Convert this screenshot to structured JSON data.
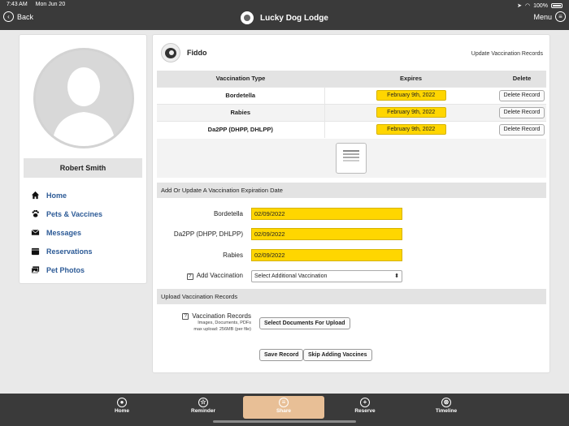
{
  "status": {
    "time": "7:43 AM",
    "date": "Mon Jun 20",
    "battery": "100%"
  },
  "header": {
    "back_label": "Back",
    "title": "Lucky Dog Lodge",
    "menu_label": "Menu"
  },
  "sidebar": {
    "user_name": "Robert Smith",
    "items": [
      {
        "label": "Home",
        "icon": "home-icon"
      },
      {
        "label": "Pets & Vaccines",
        "icon": "paw-icon"
      },
      {
        "label": "Messages",
        "icon": "envelope-icon"
      },
      {
        "label": "Reservations",
        "icon": "calendar-icon"
      },
      {
        "label": "Pet Photos",
        "icon": "photos-icon"
      }
    ],
    "link_color": "#2c5a96"
  },
  "pet": {
    "name": "Fiddo",
    "update_link": "Update Vaccination Records"
  },
  "vax_table": {
    "headers": [
      "Vaccination Type",
      "Expires",
      "Delete"
    ],
    "rows": [
      {
        "type": "Bordetella",
        "expires": "February 9th, 2022",
        "action": "Delete Record"
      },
      {
        "type": "Rabies",
        "expires": "February 9th, 2022",
        "action": "Delete Record"
      },
      {
        "type": "Da2PP (DHPP, DHLPP)",
        "expires": "February 9th, 2022",
        "action": "Delete Record"
      }
    ]
  },
  "update_section": {
    "title": "Add Or Update A Vaccination Expiration Date",
    "fields": [
      {
        "label": "Bordetella",
        "value": "02/09/2022"
      },
      {
        "label": "Da2PP (DHPP, DHLPP)",
        "value": "02/09/2022"
      },
      {
        "label": "Rabies",
        "value": "02/09/2022"
      }
    ],
    "add_label": "Add Vaccination",
    "add_select": "Select Additional Vaccination"
  },
  "upload_section": {
    "title": "Upload Vaccination Records",
    "label": "Vaccination Records",
    "hint1": "Images, Documents, PDFs",
    "hint2": "max upload: 256MB (per file)",
    "select_button": "Select Documents For Upload",
    "save_button": "Save Record",
    "skip_button": "Skip Adding Vaccines"
  },
  "tabbar": {
    "tabs": [
      {
        "label": "Home",
        "icon": "user-circle-icon"
      },
      {
        "label": "Reminder",
        "icon": "star-icon"
      },
      {
        "label": "Share",
        "icon": "share-icon"
      },
      {
        "label": "Reserve",
        "icon": "plus-icon"
      },
      {
        "label": "Timeline",
        "icon": "timeline-icon"
      }
    ],
    "active": "Share",
    "active_color": "#e8bf96"
  },
  "colors": {
    "highlight_yellow": "#ffd600",
    "bar_dark": "#3a3a3a"
  }
}
